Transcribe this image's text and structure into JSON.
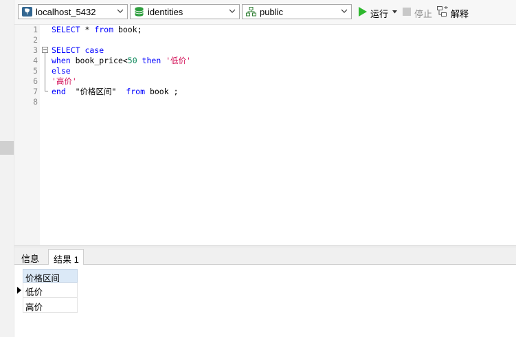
{
  "toolbar": {
    "connection": "localhost_5432",
    "database": "identities",
    "schema": "public",
    "run_label": "运行",
    "stop_label": "停止",
    "explain_label": "解释"
  },
  "editor": {
    "line_numbers": [
      "1",
      "2",
      "3",
      "4",
      "5",
      "6",
      "7",
      "8"
    ],
    "lines": [
      [
        {
          "t": "SELECT",
          "c": "kw"
        },
        {
          "t": " * ",
          "c": ""
        },
        {
          "t": "from",
          "c": "kw"
        },
        {
          "t": " book;",
          "c": ""
        }
      ],
      [],
      [
        {
          "t": "SELECT case",
          "c": "kw"
        }
      ],
      [
        {
          "t": "when",
          "c": "kw"
        },
        {
          "t": " book_price<",
          "c": ""
        },
        {
          "t": "50",
          "c": "num"
        },
        {
          "t": " then ",
          "c": "kw"
        },
        {
          "t": "'低价'",
          "c": "str"
        }
      ],
      [
        {
          "t": "else",
          "c": "kw"
        }
      ],
      [
        {
          "t": "'高价'",
          "c": "str"
        }
      ],
      [
        {
          "t": "end",
          "c": "kw"
        },
        {
          "t": "  \"价格区间\"  ",
          "c": ""
        },
        {
          "t": "from",
          "c": "kw"
        },
        {
          "t": " book ;",
          "c": ""
        }
      ],
      []
    ]
  },
  "tabs": [
    {
      "label": "信息",
      "active": false
    },
    {
      "label": "结果 1",
      "active": true
    }
  ],
  "result": {
    "column": "价格区间",
    "rows": [
      "低价",
      "高价"
    ]
  }
}
